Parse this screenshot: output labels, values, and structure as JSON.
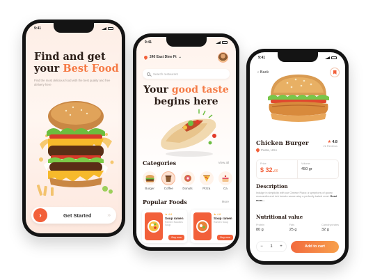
{
  "colors": {
    "accent": "#f2603a",
    "accent_light": "#f57b46",
    "dark_text": "#2b1d17"
  },
  "onboarding": {
    "status_time": "9:41",
    "title_line1": "Find and get",
    "title_your": "your",
    "title_accent": "Best Food",
    "subtitle": "Find the most delicious food with the best quality and free delivery here",
    "cta_label": "Get Started",
    "cta_arrow": "›",
    "cta_trailing": "› ›"
  },
  "home": {
    "status_time": "9:41",
    "location": "240 East Dine Ft",
    "location_chevron": "⌄",
    "search_placeholder": "Search restaurant",
    "headline_your": "Your",
    "headline_accent": "good taste",
    "headline_line2": "begins here",
    "categories_title": "Categories",
    "see_all": "View all",
    "categories": [
      {
        "label": "Burger",
        "icon": "burger-icon"
      },
      {
        "label": "Coffee",
        "icon": "coffee-icon"
      },
      {
        "label": "Donuts",
        "icon": "donut-icon"
      },
      {
        "label": "Pizza",
        "icon": "pizza-icon"
      },
      {
        "label": "Ca",
        "icon": "cake-icon"
      }
    ],
    "popular_title": "Popular Foods",
    "popular_see_all": "More",
    "popular": [
      {
        "rating": "★ 4.8",
        "name": "Soup ramen",
        "desc": "Ramen Noodles Soup",
        "price": "$40.00",
        "button": "Buy now"
      },
      {
        "rating": "★ 4.8",
        "name": "Soup ramen",
        "desc": "Ramen Soup",
        "price": "$40.00",
        "button": "Buy now"
      }
    ]
  },
  "detail": {
    "status_time": "9:41",
    "back_label": "Back",
    "name": "Chicken Burger",
    "store": "Pasta, USA",
    "rating": "4.8",
    "reviews": "2k Reviews",
    "price_label": "Price",
    "price": "$ 32.",
    "price_cents": "00",
    "volume_label": "Volume",
    "volume": "450 gr",
    "description_title": "Description",
    "description": "Indulge in simplicity with our Cheese Pizza: a symphony of gooey mozzarella and rich tomato sauce atop a perfectly baked crust.",
    "read_more": "Read more...",
    "nutrition_title": "Nutritional value",
    "nutrition": [
      {
        "label": "Protein",
        "value": "80 g"
      },
      {
        "label": "Fats",
        "value": "25 g"
      },
      {
        "label": "Carbohydrates",
        "value": "32 g"
      }
    ],
    "qty_minus": "−",
    "qty": "1",
    "qty_plus": "+",
    "add_to_cart": "Add to cart"
  }
}
